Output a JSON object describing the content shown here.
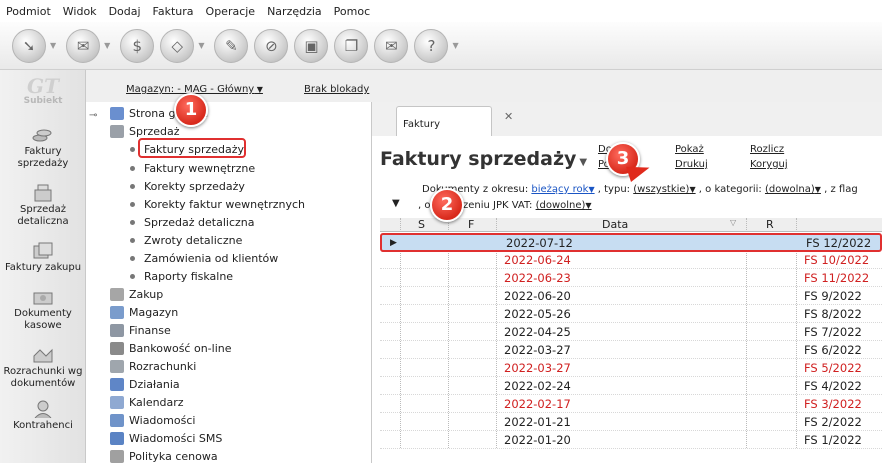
{
  "menu": [
    "Podmiot",
    "Widok",
    "Dodaj",
    "Faktura",
    "Operacje",
    "Narzędzia",
    "Pomoc"
  ],
  "logo": {
    "text": "Subiekt"
  },
  "nav": [
    {
      "label": "Faktury sprzedaży",
      "icon": "coins-icon"
    },
    {
      "label": "Sprzedaż detaliczna",
      "icon": "cash-register-icon"
    },
    {
      "label": "Faktury zakupu",
      "icon": "purchase-icon"
    },
    {
      "label": "Dokumenty kasowe",
      "icon": "cash-documents-icon"
    },
    {
      "label": "Rozrachunki wg dokumentów",
      "icon": "settlements-icon"
    },
    {
      "label": "Kontrahenci",
      "icon": "contractor-icon"
    }
  ],
  "topstrip": {
    "magazyn": "Magazyn: - MAG - Główny",
    "brak_blokady": "Brak blokady"
  },
  "tree": {
    "strona_glowna": "Strona główna",
    "sprzedaz": "Sprzedaż",
    "sub": [
      "Faktury sprzedaży",
      "Faktury wewnętrzne",
      "Korekty sprzedaży",
      "Korekty faktur wewnętrznych",
      "Sprzedaż detaliczna",
      "Zwroty detaliczne",
      "Zamówienia od klientów",
      "Raporty fiskalne"
    ],
    "groups": [
      "Zakup",
      "Magazyn",
      "Finanse",
      "Bankowość on-line",
      "Rozrachunki",
      "Działania",
      "Kalendarz",
      "Wiadomości",
      "Wiadomości SMS",
      "Polityka cenowa"
    ]
  },
  "tab": {
    "label": "Faktury sprzedaży"
  },
  "content": {
    "title": "Faktury sprzedaży",
    "actions": {
      "dodaj": "Dodaj",
      "popraw": "Popraw",
      "pokaz": "Pokaż",
      "drukuj": "Drukuj",
      "rozlicz": "Rozlicz",
      "koryguj": "Koryguj"
    },
    "filter": {
      "okres_label": "Dokumenty z okresu:",
      "okres_value": "bieżący rok",
      "typ_label": ", typu:",
      "typ_value": "(wszystkie)",
      "kategoria_label": ", o kategorii:",
      "kategoria_value": "(dowolna)",
      "flag_label": ", z flag",
      "jpk_label": ", o oznaczeniu JPK VAT:",
      "jpk_value": "(dowolne)"
    }
  },
  "grid": {
    "headers": {
      "s": "S",
      "f": "F",
      "data": "Data",
      "r": "R"
    },
    "rows": [
      {
        "date": "2022-07-12",
        "number": "FS 12/2022",
        "red": false,
        "selected": true
      },
      {
        "date": "2022-06-24",
        "number": "FS 10/2022",
        "red": true,
        "selected": false
      },
      {
        "date": "2022-06-23",
        "number": "FS 11/2022",
        "red": true,
        "selected": false
      },
      {
        "date": "2022-06-20",
        "number": "FS 9/2022",
        "red": false,
        "selected": false
      },
      {
        "date": "2022-05-26",
        "number": "FS 8/2022",
        "red": false,
        "selected": false
      },
      {
        "date": "2022-04-25",
        "number": "FS 7/2022",
        "red": false,
        "selected": false
      },
      {
        "date": "2022-03-27",
        "number": "FS 6/2022",
        "red": false,
        "selected": false
      },
      {
        "date": "2022-03-27",
        "number": "FS 5/2022",
        "red": true,
        "selected": false
      },
      {
        "date": "2022-02-24",
        "number": "FS 4/2022",
        "red": false,
        "selected": false
      },
      {
        "date": "2022-02-17",
        "number": "FS 3/2022",
        "red": true,
        "selected": false
      },
      {
        "date": "2022-01-21",
        "number": "FS 2/2022",
        "red": false,
        "selected": false
      },
      {
        "date": "2022-01-20",
        "number": "FS 1/2022",
        "red": false,
        "selected": false
      }
    ]
  },
  "badges": [
    "1",
    "2",
    "3"
  ],
  "colors": {
    "accent_red": "#e03030",
    "selection": "#c7ddf2",
    "link": "#1a55c4"
  }
}
